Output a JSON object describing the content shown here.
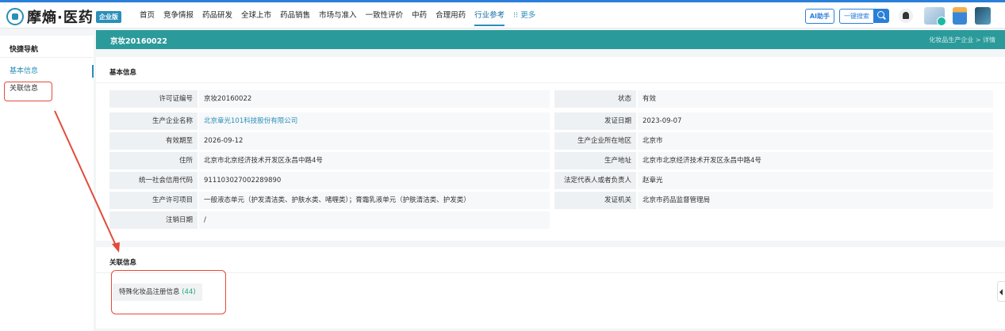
{
  "brand": {
    "name": "摩熵·医药",
    "badge": "企业版"
  },
  "nav": {
    "items": [
      "首页",
      "竞争情报",
      "药品研发",
      "全球上市",
      "药品销售",
      "市场与准入",
      "一致性评价",
      "中药",
      "合理用药",
      "行业参考"
    ],
    "active": "行业参考",
    "more": "⁝⁝ 更多"
  },
  "toolbar": {
    "ai_label": "AI助手",
    "search_label": "一键搜索"
  },
  "sidebar": {
    "title": "快捷导航",
    "items": [
      {
        "label": "基本信息",
        "active": true
      },
      {
        "label": "关联信息",
        "active": false
      }
    ]
  },
  "header": {
    "title": "京妆20160022",
    "breadcrumb": "化妆品生产企业 > 详情"
  },
  "basic_info": {
    "title": "基本信息",
    "rows": [
      {
        "l1": "许可证编号",
        "v1": "京妆20160022",
        "l2": "状态",
        "v2": "有效"
      },
      {
        "l1": "生产企业名称",
        "v1": "北京章光101科技股份有限公司",
        "l2": "发证日期",
        "v2": "2023-09-07"
      },
      {
        "l1": "有效期至",
        "v1": "2026-09-12",
        "l2": "生产企业所在地区",
        "v2": "北京市"
      },
      {
        "l1": "住所",
        "v1": "北京市北京经济技术开发区永昌中路4号",
        "l2": "生产地址",
        "v2": "北京市北京经济技术开发区永昌中路4号"
      },
      {
        "l1": "统一社会信用代码",
        "v1": "911103027002289890",
        "l2": "法定代表人或者负责人",
        "v2": "赵章光"
      },
      {
        "l1": "生产许可项目",
        "v1": "一般液态单元（护发清洁类、护肤水类、啫喱类）；膏霜乳液单元（护肤清洁类、护发类）",
        "l2": "发证机关",
        "v2": "北京市药品监督管理局"
      },
      {
        "l1": "注销日期",
        "v1": "/"
      }
    ]
  },
  "related": {
    "title": "关联信息",
    "tag_label": "特殊化妆品注册信息",
    "tag_count": "(44)"
  },
  "colors": {
    "accent": "#2b9a9a",
    "annotation": "#e34a3a",
    "link": "#2a8fb8"
  }
}
